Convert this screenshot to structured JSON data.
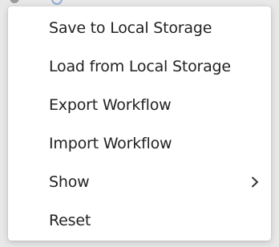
{
  "menu": {
    "items": [
      {
        "label": "Save to Local Storage"
      },
      {
        "label": "Load from Local Storage"
      },
      {
        "label": "Export Workflow"
      },
      {
        "label": "Import Workflow"
      },
      {
        "label": "Show",
        "icon": "chevron-right-icon"
      },
      {
        "label": "Reset"
      }
    ]
  },
  "toolbar_peek": {
    "icons": [
      "gear-icon",
      "circle-icon"
    ]
  },
  "colors": {
    "menu_background": "#ffffff",
    "text": "#222222",
    "backdrop": "#e8e8e8"
  }
}
